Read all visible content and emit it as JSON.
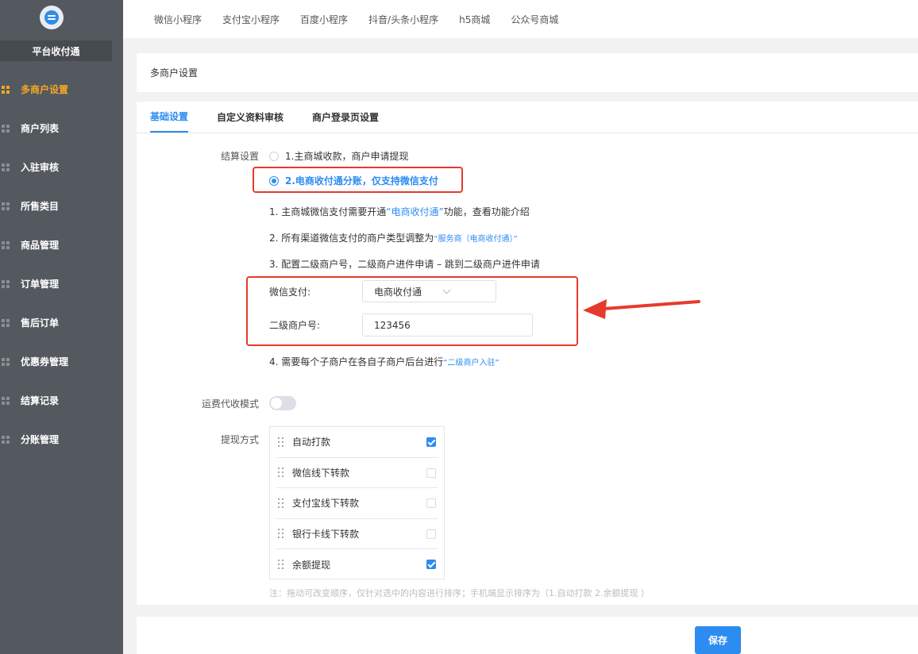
{
  "sidebar": {
    "brand": "平台收付通",
    "items": [
      {
        "label": "多商户设置",
        "active": true
      },
      {
        "label": "商户列表"
      },
      {
        "label": "入驻审核"
      },
      {
        "label": "所售类目"
      },
      {
        "label": "商品管理"
      },
      {
        "label": "订单管理"
      },
      {
        "label": "售后订单"
      },
      {
        "label": "优惠券管理"
      },
      {
        "label": "结算记录"
      },
      {
        "label": "分账管理"
      }
    ]
  },
  "topbar": {
    "tabs": [
      "微信小程序",
      "支付宝小程序",
      "百度小程序",
      "抖音/头条小程序",
      "h5商城",
      "公众号商城"
    ]
  },
  "panel": {
    "title": "多商户设置",
    "tabs": [
      "基础设置",
      "自定义资料审核",
      "商户登录页设置"
    ],
    "active_tab": "基础设置"
  },
  "settlement": {
    "label": "结算设置",
    "option1": "1.主商城收款，商户申请提现",
    "option2": "2.电商收付通分账，仅支持微信支付",
    "selected": 2,
    "step1_a": "1. 主商城微信支付需要开通",
    "step1_link": "“电商收付通”",
    "step1_b": "功能，查看功能介绍",
    "step2_a": "2. 所有渠道微信支付的商户类型调整为",
    "step2_link": "“服务商（电商收付通）”",
    "step3": "3. 配置二级商户号，二级商户进件申请 – 跳到二级商户进件申请",
    "wechat_pay_label": "微信支付:",
    "wechat_pay_value": "电商收付通",
    "sub_merchant_label": "二级商户号:",
    "sub_merchant_value": "123456",
    "step4_a": "4. 需要每个子商户在各自子商户后台进行",
    "step4_link": "“二级商户入驻”"
  },
  "freight": {
    "label": "运费代收模式",
    "enabled": false
  },
  "withdraw": {
    "label": "提现方式",
    "items": [
      {
        "label": "自动打款",
        "checked": true
      },
      {
        "label": "微信线下转款",
        "checked": false
      },
      {
        "label": "支付宝线下转款",
        "checked": false
      },
      {
        "label": "银行卡线下转款",
        "checked": false
      },
      {
        "label": "余额提现",
        "checked": true
      }
    ],
    "note": "注：拖动可改变顺序，仅针对选中的内容进行排序；手机端显示排序为（1.自动打款 2.余额提现 ）"
  },
  "footer": {
    "save_label": "保存"
  },
  "colors": {
    "primary": "#2d8cf0",
    "sidebar_bg": "#54595f",
    "active_nav": "#f5a623",
    "annotation_red": "#e53b2c"
  }
}
